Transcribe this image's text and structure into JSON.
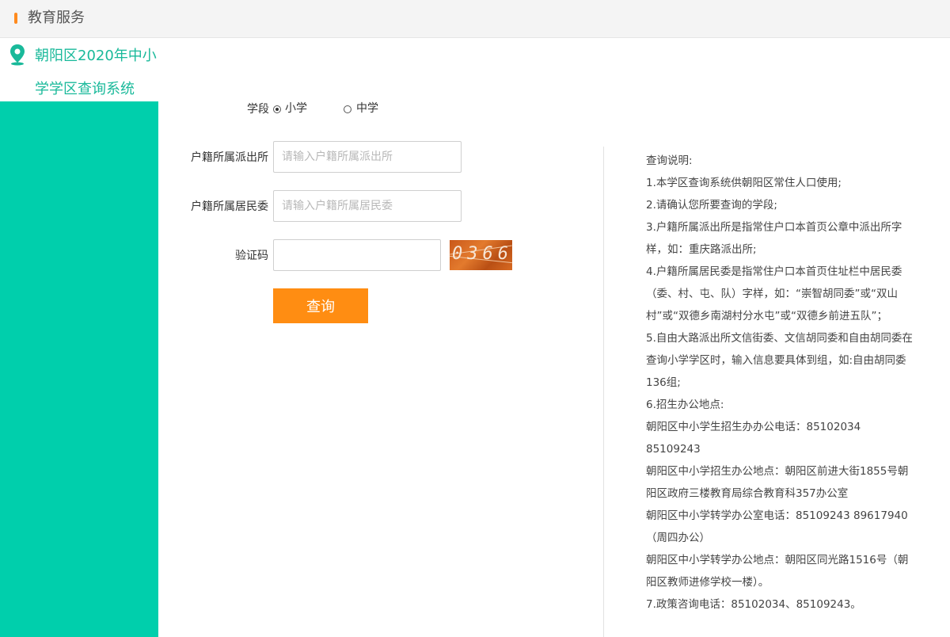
{
  "header": {
    "title": "教育服务"
  },
  "sidebar": {
    "title_line1": "朝阳区2020年中小",
    "title_line2": "学学区查询系统"
  },
  "form": {
    "stage_label": "学段",
    "stage_options": [
      {
        "label": "小学",
        "checked": true
      },
      {
        "label": "中学",
        "checked": false
      }
    ],
    "police_label": "户籍所属派出所",
    "police_placeholder": "请输入户籍所属派出所",
    "committee_label": "户籍所属居民委",
    "committee_placeholder": "请输入户籍所属居民委",
    "captcha_label": "验证码",
    "captcha_value": "",
    "captcha_image_text": "0366",
    "query_button": "查询"
  },
  "notes": [
    "查询说明:",
    "1.本学区查询系统供朝阳区常住人口使用;",
    "2.请确认您所要查询的学段;",
    "3.户籍所属派出所是指常住户口本首页公章中派出所字样，如：重庆路派出所;",
    "4.户籍所属居民委是指常住户口本首页住址栏中居民委（委、村、屯、队）字样，如：“崇智胡同委”或“双山村”或“双德乡南湖村分水屯”或“双德乡前进五队”；",
    "5.自由大路派出所文信街委、文信胡同委和自由胡同委在查询小学学区时，输入信息要具体到组，如:自由胡同委136组;",
    "6.招生办公地点:",
    "朝阳区中小学生招生办办公电话：85102034",
    "85109243",
    "朝阳区中小学招生办公地点：朝阳区前进大街1855号朝阳区政府三楼教育局综合教育科357办公室",
    "朝阳区中小学转学办公室电话：85109243 89617940（周四办公）",
    "朝阳区中小学转学办公地点：朝阳区同光路1516号（朝阳区教师进修学校一楼）。",
    "7.政策咨询电话：85102034、85109243。"
  ],
  "colors": {
    "accent": "#ff8a1e",
    "sidebar": "#00cfac",
    "sidebar_title": "#19b99a",
    "button": "#ff8d12"
  }
}
